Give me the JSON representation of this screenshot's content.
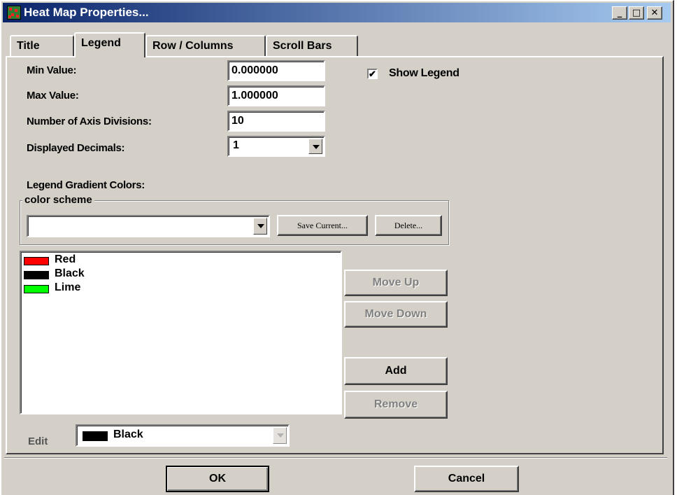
{
  "window": {
    "title": "Heat Map Properties...",
    "minimize_glyph": "_",
    "maximize_glyph": "□",
    "close_glyph": "✕"
  },
  "tabs": [
    {
      "label": "Title",
      "active": false
    },
    {
      "label": "Legend",
      "active": true
    },
    {
      "label": "Row / Columns",
      "active": false
    },
    {
      "label": "Scroll Bars",
      "active": false
    }
  ],
  "legend": {
    "min_value_label": "Min Value:",
    "min_value": "0.000000",
    "max_value_label": "Max Value:",
    "max_value": "1.000000",
    "axis_divisions_label": "Number of Axis Divisions:",
    "axis_divisions": "10",
    "decimals_label": "Displayed Decimals:",
    "decimals": "1",
    "show_legend_label": "Show Legend",
    "show_legend_checked": true,
    "checkmark": "✔",
    "gradient_colors_label": "Legend Gradient Colors:"
  },
  "color_scheme": {
    "group_label": "color scheme",
    "selected": "",
    "save_button": "Save Current...",
    "delete_button": "Delete..."
  },
  "color_list": [
    {
      "name": "Red",
      "color": "#ff0000"
    },
    {
      "name": "Black",
      "color": "#000000"
    },
    {
      "name": "Lime",
      "color": "#00ff00"
    }
  ],
  "list_buttons": {
    "move_up": "Move Up",
    "move_down": "Move Down",
    "add": "Add",
    "remove": "Remove"
  },
  "edit": {
    "label": "Edit",
    "selected_name": "Black",
    "selected_color": "#000000"
  },
  "footer": {
    "ok": "OK",
    "cancel": "Cancel"
  }
}
